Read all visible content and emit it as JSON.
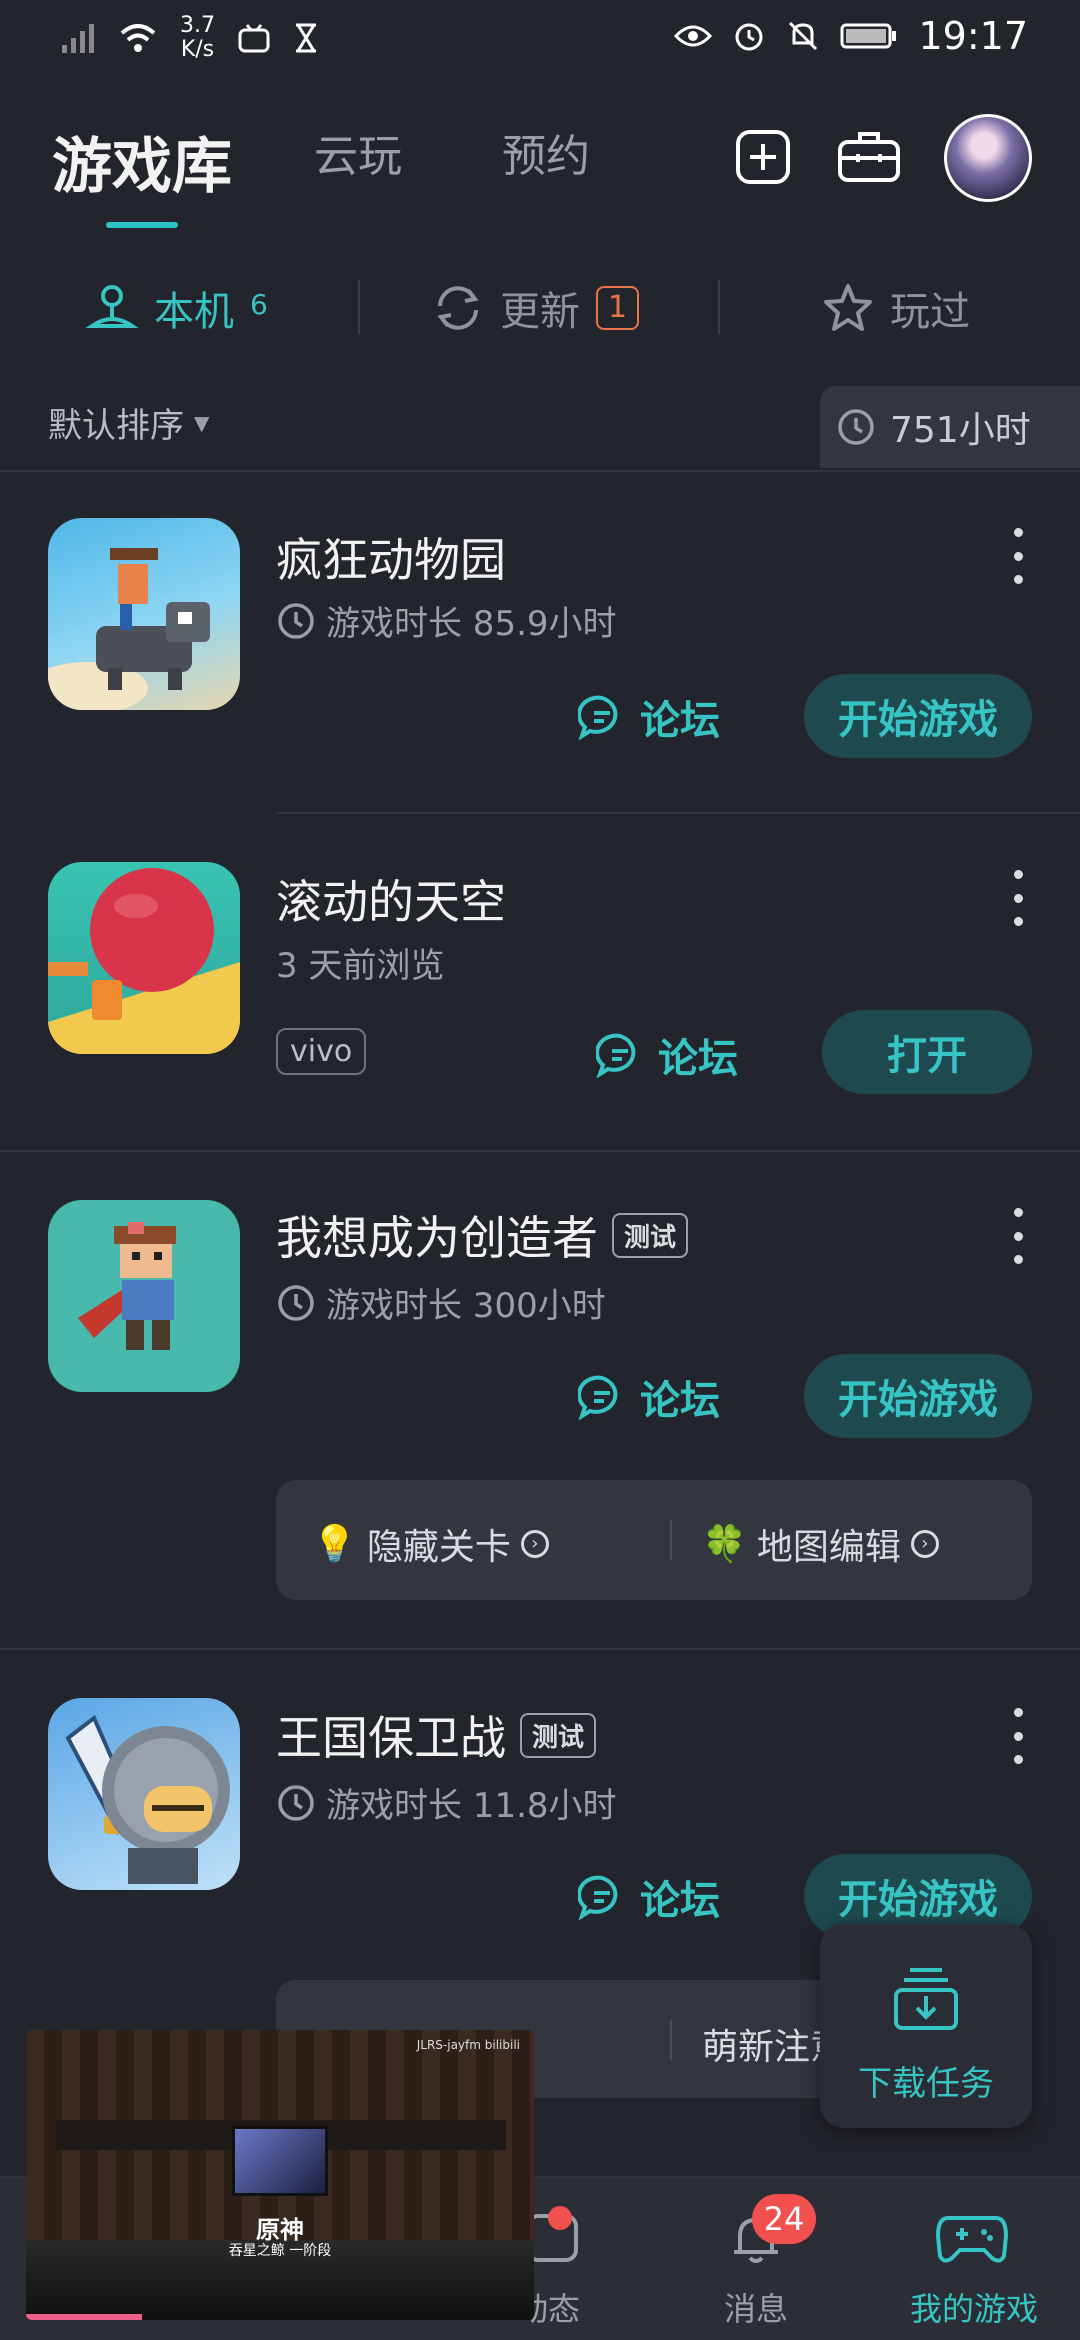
{
  "status_bar": {
    "speed_value": "3.7",
    "speed_unit": "K/s",
    "time": "19:17"
  },
  "header": {
    "title": "游戏库",
    "tab_cloud": "云玩",
    "tab_reserve": "预约"
  },
  "subtabs": {
    "local_label": "本机",
    "local_count": "6",
    "update_label": "更新",
    "update_badge": "1",
    "played_label": "玩过"
  },
  "sort_label": "默认排序",
  "total_hours": "751小时",
  "games": [
    {
      "title": "疯狂动物园",
      "subtitle": "游戏时长 85.9小时",
      "forum": "论坛",
      "action": "开始游戏"
    },
    {
      "title": "滚动的天空",
      "subtitle": "3 天前浏览",
      "badge": "vivo",
      "forum": "论坛",
      "action": "打开"
    },
    {
      "title": "我想成为创造者",
      "tag": "测试",
      "subtitle": "游戏时长 300小时",
      "forum": "论坛",
      "action": "开始游戏",
      "extras": [
        "隐藏关卡",
        "地图编辑"
      ]
    },
    {
      "title": "王国保卫战",
      "tag": "测试",
      "subtitle": "游戏时长 11.8小时",
      "forum": "论坛",
      "action": "开始游戏",
      "extras": [
        "萌新注意"
      ]
    }
  ],
  "download_task": "下载任务",
  "bottom_nav": {
    "dynamic": "动态",
    "messages": "消息",
    "messages_badge": "24",
    "my_games": "我的游戏"
  },
  "video": {
    "watermark": "JLRS-jayfm bilibili",
    "caption_title": "原神",
    "caption_sub": "吞星之鲸 一阶段"
  },
  "colors": {
    "accent": "#37c4c4",
    "background": "#23252c",
    "badge_red": "#f24f4f",
    "update_orange": "#e8744a"
  }
}
